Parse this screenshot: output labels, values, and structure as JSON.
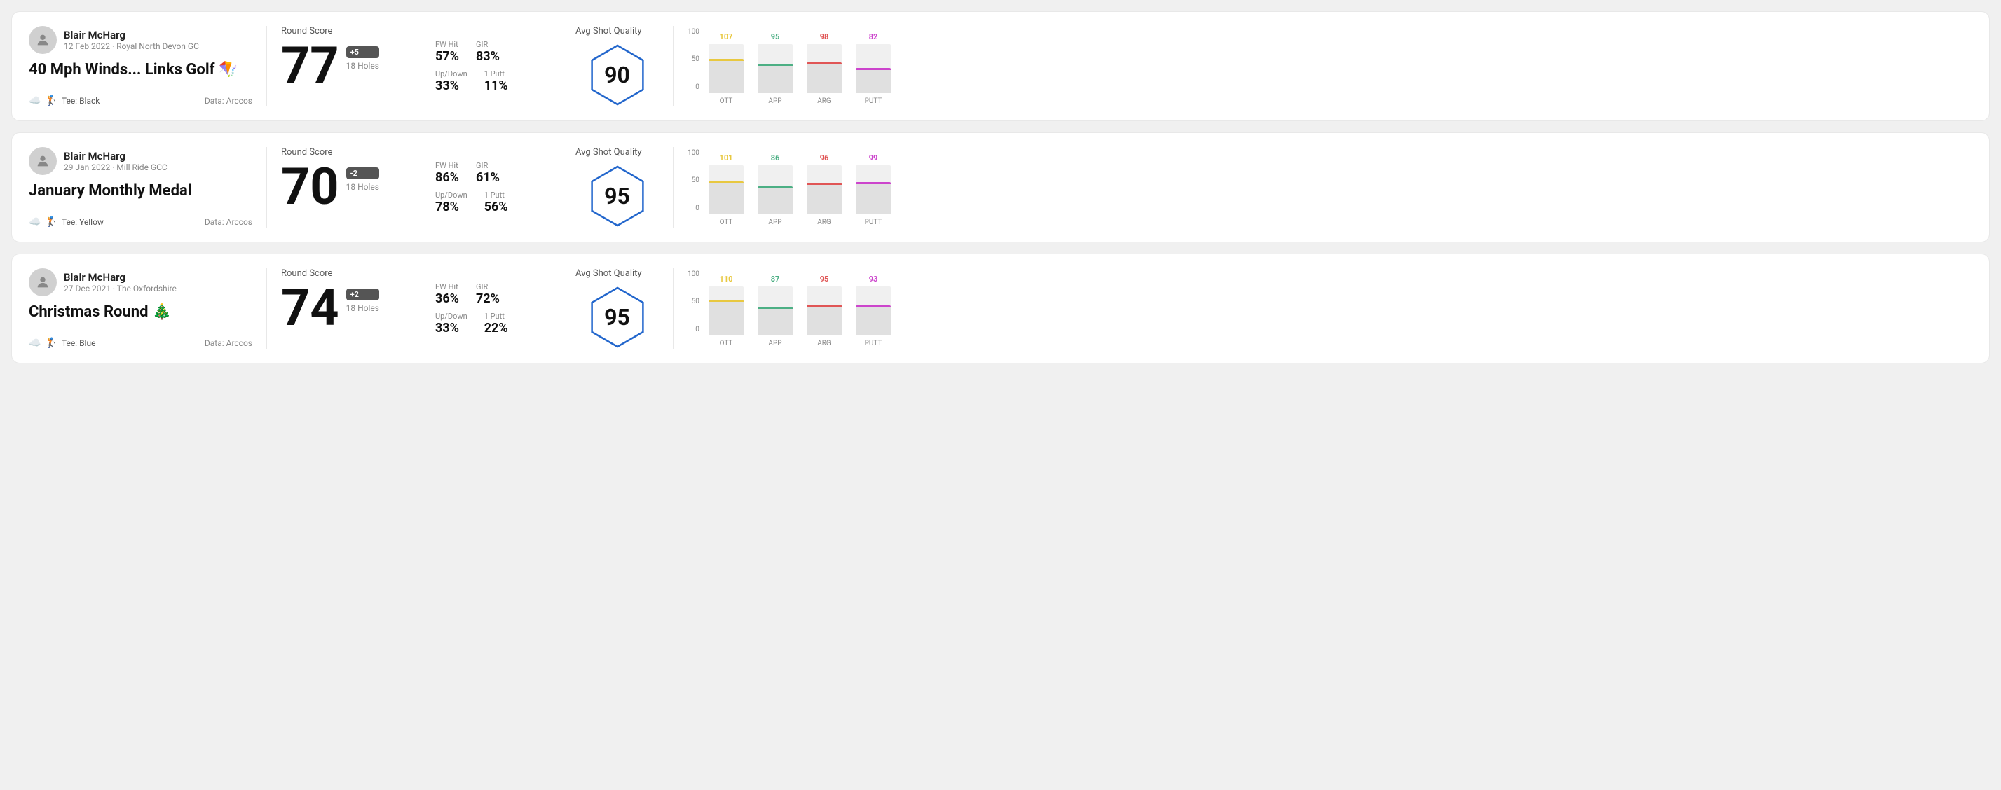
{
  "rounds": [
    {
      "id": "round1",
      "user": {
        "name": "Blair McHarg",
        "date_course": "12 Feb 2022 · Royal North Devon GC"
      },
      "title": "40 Mph Winds... Links Golf 🪁",
      "tee": "Tee: Black",
      "data_source": "Data: Arccos",
      "score": "77",
      "score_diff": "+5",
      "holes": "18 Holes",
      "fw_hit_label": "FW Hit",
      "fw_hit_value": "57%",
      "gir_label": "GIR",
      "gir_value": "83%",
      "updown_label": "Up/Down",
      "updown_value": "33%",
      "one_putt_label": "1 Putt",
      "one_putt_value": "11%",
      "quality_label": "Avg Shot Quality",
      "quality_score": "90",
      "chart": {
        "bars": [
          {
            "label": "OTT",
            "value": 107,
            "color": "#e8c840",
            "pct": 70
          },
          {
            "label": "APP",
            "value": 95,
            "color": "#4caf84",
            "pct": 60
          },
          {
            "label": "ARG",
            "value": 98,
            "color": "#e05555",
            "pct": 63
          },
          {
            "label": "PUTT",
            "value": 82,
            "color": "#cc44cc",
            "pct": 52
          }
        ],
        "y_labels": [
          "100",
          "50",
          "0"
        ]
      }
    },
    {
      "id": "round2",
      "user": {
        "name": "Blair McHarg",
        "date_course": "29 Jan 2022 · Mill Ride GCC"
      },
      "title": "January Monthly Medal",
      "tee": "Tee: Yellow",
      "data_source": "Data: Arccos",
      "score": "70",
      "score_diff": "-2",
      "holes": "18 Holes",
      "fw_hit_label": "FW Hit",
      "fw_hit_value": "86%",
      "gir_label": "GIR",
      "gir_value": "61%",
      "updown_label": "Up/Down",
      "updown_value": "78%",
      "one_putt_label": "1 Putt",
      "one_putt_value": "56%",
      "quality_label": "Avg Shot Quality",
      "quality_score": "95",
      "chart": {
        "bars": [
          {
            "label": "OTT",
            "value": 101,
            "color": "#e8c840",
            "pct": 67
          },
          {
            "label": "APP",
            "value": 86,
            "color": "#4caf84",
            "pct": 57
          },
          {
            "label": "ARG",
            "value": 96,
            "color": "#e05555",
            "pct": 64
          },
          {
            "label": "PUTT",
            "value": 99,
            "color": "#cc44cc",
            "pct": 66
          }
        ],
        "y_labels": [
          "100",
          "50",
          "0"
        ]
      }
    },
    {
      "id": "round3",
      "user": {
        "name": "Blair McHarg",
        "date_course": "27 Dec 2021 · The Oxfordshire"
      },
      "title": "Christmas Round 🎄",
      "tee": "Tee: Blue",
      "data_source": "Data: Arccos",
      "score": "74",
      "score_diff": "+2",
      "holes": "18 Holes",
      "fw_hit_label": "FW Hit",
      "fw_hit_value": "36%",
      "gir_label": "GIR",
      "gir_value": "72%",
      "updown_label": "Up/Down",
      "updown_value": "33%",
      "one_putt_label": "1 Putt",
      "one_putt_value": "22%",
      "quality_label": "Avg Shot Quality",
      "quality_score": "95",
      "chart": {
        "bars": [
          {
            "label": "OTT",
            "value": 110,
            "color": "#e8c840",
            "pct": 73
          },
          {
            "label": "APP",
            "value": 87,
            "color": "#4caf84",
            "pct": 58
          },
          {
            "label": "ARG",
            "value": 95,
            "color": "#e05555",
            "pct": 63
          },
          {
            "label": "PUTT",
            "value": 93,
            "color": "#cc44cc",
            "pct": 62
          }
        ],
        "y_labels": [
          "100",
          "50",
          "0"
        ]
      }
    }
  ],
  "labels": {
    "round_score": "Round Score",
    "avg_shot_quality": "Avg Shot Quality"
  }
}
